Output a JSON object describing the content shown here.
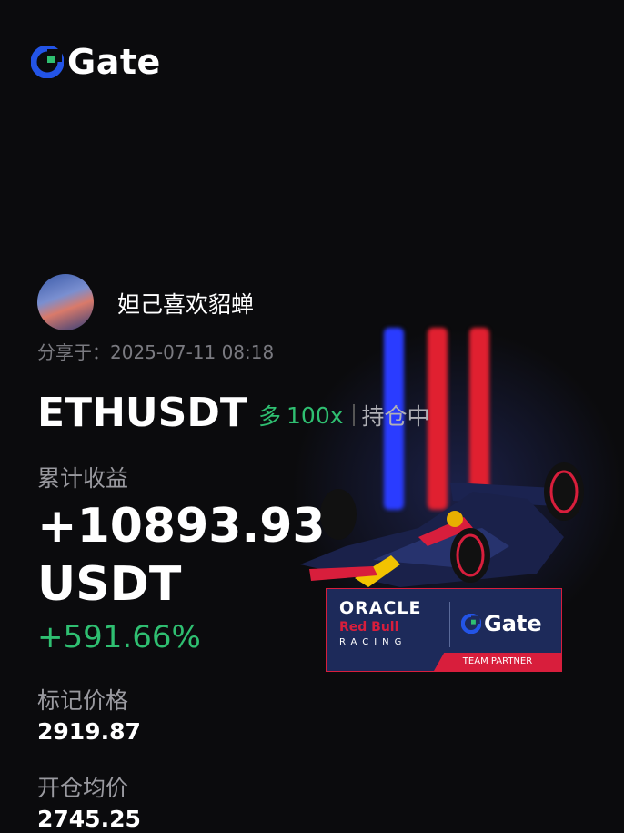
{
  "brand": {
    "name": "Gate",
    "accent": "#2354e6",
    "green": "#2fbf71"
  },
  "user": {
    "name": "妲己喜欢貂蝉",
    "share_time": "分享于：2025-07-11 08:18"
  },
  "position": {
    "pair": "ETHUSDT",
    "direction": "多",
    "leverage": "100x",
    "status": "持仓中"
  },
  "pnl": {
    "label": "累计收益",
    "value": "+10893.93",
    "unit": "USDT",
    "percent": "+591.66%"
  },
  "mark_price": {
    "label": "标记价格",
    "value": "2919.87"
  },
  "entry_price": {
    "label": "开仓均价",
    "value": "2745.25"
  },
  "promo": {
    "oracle": "ORACLE",
    "redbull": "Red Bull",
    "racing": "RACING",
    "partner_brand": "Gate",
    "tag": "TEAM PARTNER"
  }
}
